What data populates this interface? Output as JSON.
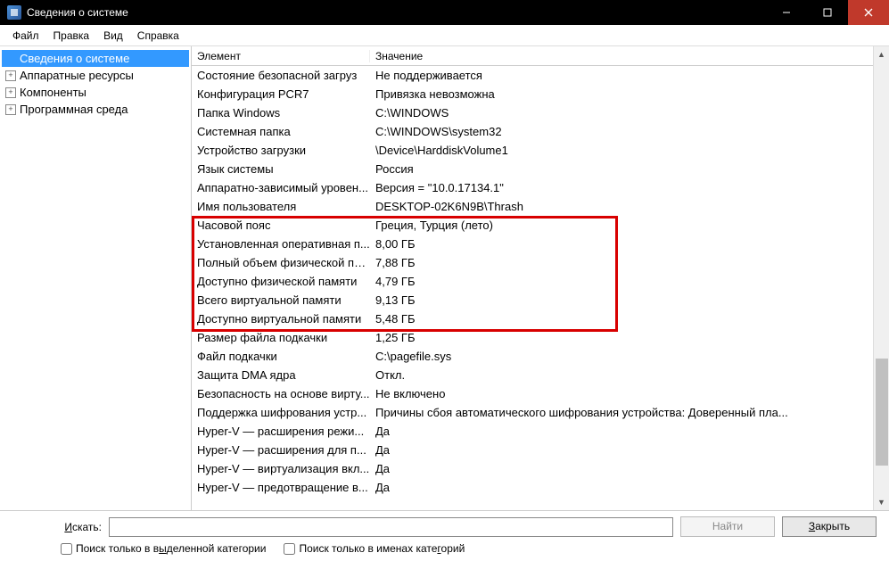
{
  "window": {
    "title": "Сведения о системе"
  },
  "menu": {
    "file": "Файл",
    "edit": "Правка",
    "view": "Вид",
    "help": "Справка"
  },
  "tree": {
    "root": "Сведения о системе",
    "hardware": "Аппаратные ресурсы",
    "components": "Компоненты",
    "software": "Программная среда"
  },
  "columns": {
    "element": "Элемент",
    "value": "Значение"
  },
  "rows": [
    {
      "k": "Состояние безопасной загруз",
      "v": "Не поддерживается"
    },
    {
      "k": "Конфигурация PCR7",
      "v": "Привязка невозможна"
    },
    {
      "k": "Папка Windows",
      "v": "C:\\WINDOWS"
    },
    {
      "k": "Системная папка",
      "v": "C:\\WINDOWS\\system32"
    },
    {
      "k": "Устройство загрузки",
      "v": "\\Device\\HarddiskVolume1"
    },
    {
      "k": "Язык системы",
      "v": "Россия"
    },
    {
      "k": "Аппаратно-зависимый уровен...",
      "v": "Версия = \"10.0.17134.1\""
    },
    {
      "k": "Имя пользователя",
      "v": "DESKTOP-02K6N9B\\Thrash"
    },
    {
      "k": "Часовой пояс",
      "v": "Греция, Турция (лето)"
    },
    {
      "k": "Установленная оперативная п...",
      "v": "8,00 ГБ"
    },
    {
      "k": "Полный объем физической па...",
      "v": "7,88 ГБ"
    },
    {
      "k": "Доступно физической памяти",
      "v": "4,79 ГБ"
    },
    {
      "k": "Всего виртуальной памяти",
      "v": "9,13 ГБ"
    },
    {
      "k": "Доступно виртуальной памяти",
      "v": "5,48 ГБ"
    },
    {
      "k": "Размер файла подкачки",
      "v": "1,25 ГБ"
    },
    {
      "k": "Файл подкачки",
      "v": "C:\\pagefile.sys"
    },
    {
      "k": "Защита DMA ядра",
      "v": "Откл."
    },
    {
      "k": "Безопасность на основе вирту...",
      "v": "Не включено"
    },
    {
      "k": "Поддержка шифрования устр...",
      "v": "Причины сбоя автоматического шифрования устройства: Доверенный пла..."
    },
    {
      "k": "Hyper-V — расширения режи...",
      "v": "Да"
    },
    {
      "k": "Hyper-V — расширения для п...",
      "v": "Да"
    },
    {
      "k": "Hyper-V — виртуализация вкл...",
      "v": "Да"
    },
    {
      "k": "Hyper-V — предотвращение в...",
      "v": "Да"
    }
  ],
  "footer": {
    "search_label_pre": "И",
    "search_label_rest": "скать:",
    "find": "Найти",
    "close_pre": "З",
    "close_rest": "акрыть",
    "check1_pre": "Поиск только в в",
    "check1_u": "ы",
    "check1_rest": "деленной категории",
    "check2_pre": "Поиск только в именах кате",
    "check2_u": "г",
    "check2_rest": "орий"
  }
}
